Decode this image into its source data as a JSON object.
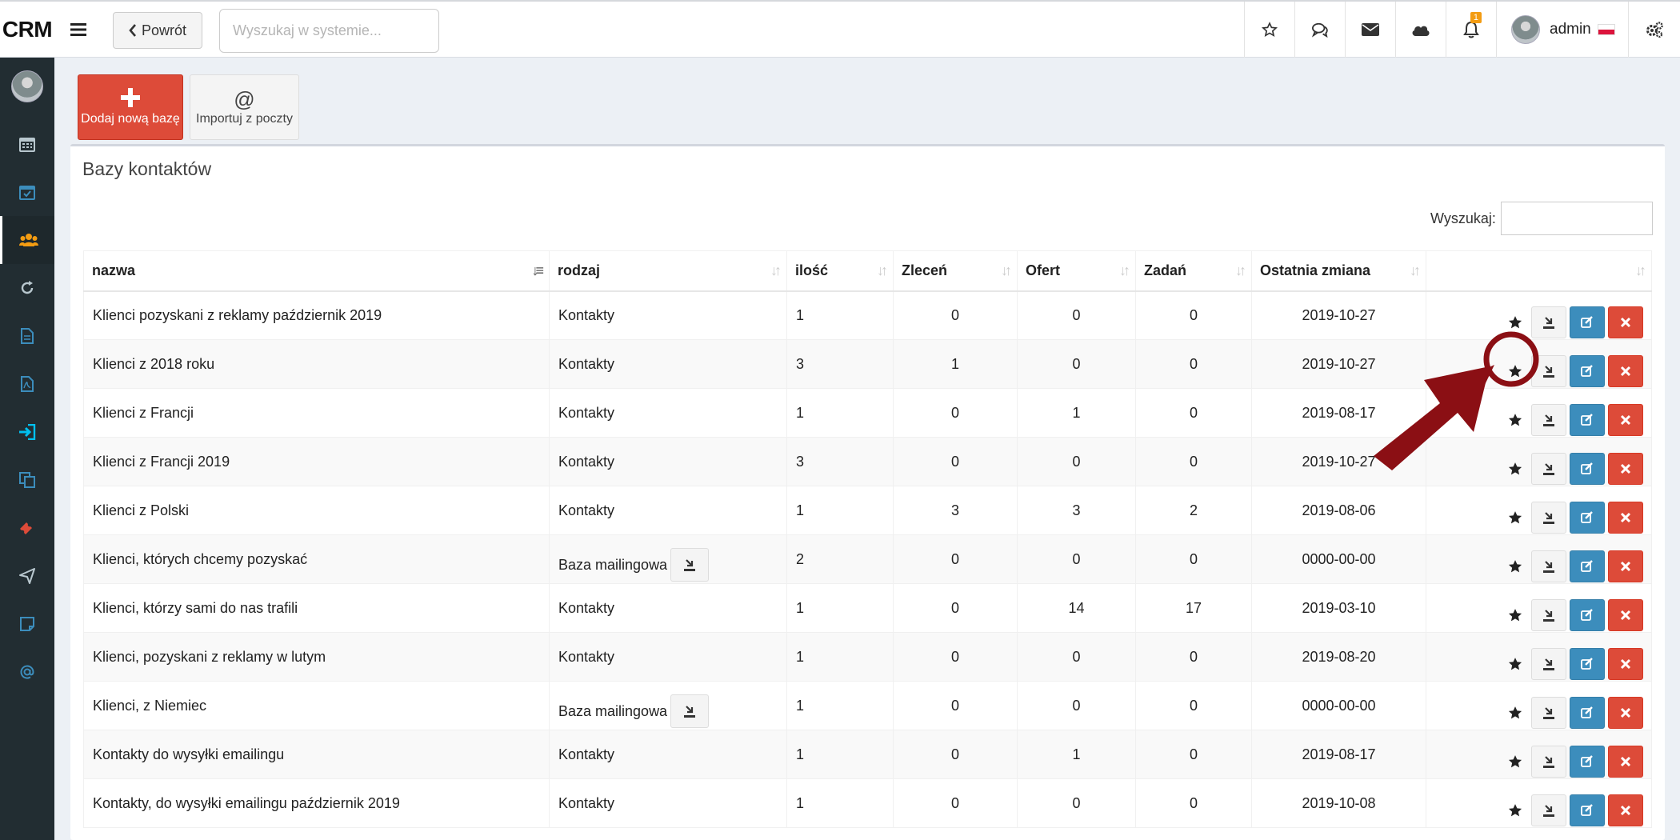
{
  "brand": "CRM",
  "header": {
    "back_label": "Powrót",
    "search_placeholder": "Wyszukaj w systemie...",
    "notifications_count": "1",
    "user_name": "admin"
  },
  "toolbar": {
    "add_label": "Dodaj nową bazę",
    "import_label": "Importuj z poczty"
  },
  "box": {
    "title": "Bazy kontaktów",
    "search_label": "Wyszukaj:"
  },
  "table": {
    "columns": [
      "nazwa",
      "rodzaj",
      "ilość",
      "Zleceń",
      "Ofert",
      "Zadań",
      "Ostatnia zmiana",
      ""
    ],
    "rows": [
      {
        "name": "Klienci pozyskani z reklamy październik 2019",
        "type": "Kontakty",
        "qty": "1",
        "orders": "0",
        "offers": "0",
        "tasks": "0",
        "changed": "2019-10-27"
      },
      {
        "name": "Klienci z 2018 roku",
        "type": "Kontakty",
        "qty": "3",
        "orders": "1",
        "offers": "0",
        "tasks": "0",
        "changed": "2019-10-27"
      },
      {
        "name": "Klienci z Francji",
        "type": "Kontakty",
        "qty": "1",
        "orders": "0",
        "offers": "1",
        "tasks": "0",
        "changed": "2019-08-17"
      },
      {
        "name": "Klienci z Francji 2019",
        "type": "Kontakty",
        "qty": "3",
        "orders": "0",
        "offers": "0",
        "tasks": "0",
        "changed": "2019-10-27"
      },
      {
        "name": "Klienci z Polski",
        "type": "Kontakty",
        "qty": "1",
        "orders": "3",
        "offers": "3",
        "tasks": "2",
        "changed": "2019-08-06"
      },
      {
        "name": "Klienci, których chcemy pozyskać",
        "type": "Baza mailingowa",
        "qty": "2",
        "orders": "0",
        "offers": "0",
        "tasks": "0",
        "changed": "0000-00-00"
      },
      {
        "name": "Klienci, którzy sami do nas trafili",
        "type": "Kontakty",
        "qty": "1",
        "orders": "0",
        "offers": "14",
        "tasks": "17",
        "changed": "2019-03-10"
      },
      {
        "name": "Klienci, pozyskani z reklamy w lutym",
        "type": "Kontakty",
        "qty": "1",
        "orders": "0",
        "offers": "0",
        "tasks": "0",
        "changed": "2019-08-20"
      },
      {
        "name": "Klienci, z Niemiec",
        "type": "Baza mailingowa",
        "qty": "1",
        "orders": "0",
        "offers": "0",
        "tasks": "0",
        "changed": "0000-00-00"
      },
      {
        "name": "Kontakty do wysyłki emailingu",
        "type": "Kontakty",
        "qty": "1",
        "orders": "0",
        "offers": "1",
        "tasks": "0",
        "changed": "2019-08-17"
      },
      {
        "name": "Kontakty, do wysyłki emailingu październik 2019",
        "type": "Kontakty",
        "qty": "1",
        "orders": "0",
        "offers": "0",
        "tasks": "0",
        "changed": "2019-10-08"
      }
    ]
  },
  "sidebar": {
    "items": [
      "calendar-icon",
      "calendar-check-icon",
      "users-icon",
      "refresh-icon",
      "file-icon",
      "pdf-file-icon",
      "sign-in-icon",
      "copy-icon",
      "ticket-icon",
      "send-icon",
      "note-icon",
      "at-icon"
    ],
    "active_item": "users-icon"
  },
  "colors": {
    "sidebar_bg": "#222d32",
    "add_button": "#dd4b39",
    "edit_button": "#3c8dbc",
    "delete_button": "#dd4b39",
    "annotation": "#8b0f14"
  }
}
